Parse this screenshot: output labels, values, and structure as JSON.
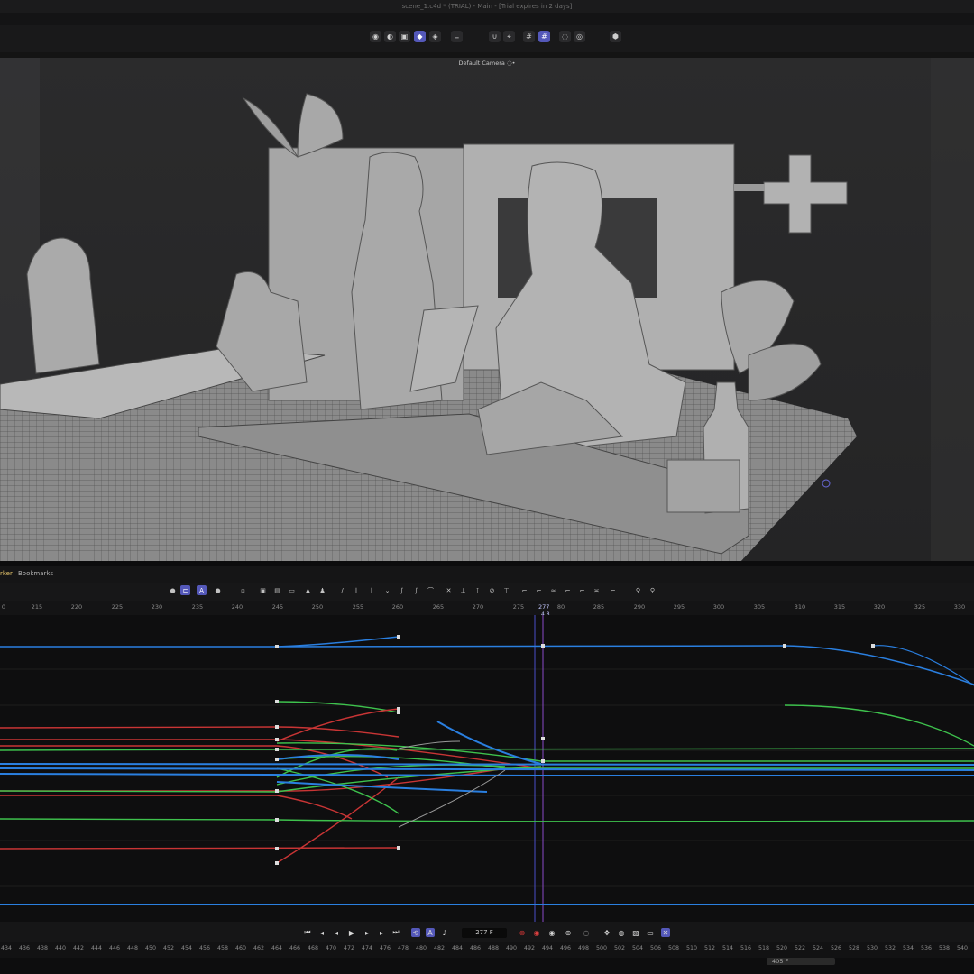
{
  "window": {
    "title": "scene_1.c4d * (TRIAL) - Main - [Trial expires in 2 days]"
  },
  "viewport": {
    "camera_label": "Default Camera ◌•"
  },
  "toolbar": {
    "icons": [
      "view-icon",
      "light-icon",
      "cube-icon",
      "display-icon",
      "shading-icon",
      "snap-icon",
      "magnet-icon",
      "grid-icon",
      "grid2-icon",
      "render-icon",
      "settings-icon",
      "axis-icon"
    ]
  },
  "timeline": {
    "tabs": [
      "rker",
      "Bookmarks"
    ],
    "ruler_ticks": [
      "0",
      "215",
      "220",
      "225",
      "230",
      "235",
      "240",
      "245",
      "250",
      "255",
      "260",
      "265",
      "270",
      "275",
      "80",
      "285",
      "290",
      "295",
      "300",
      "305",
      "310",
      "315",
      "320",
      "325",
      "330"
    ],
    "playhead_frame": "277",
    "playhead_sub": "4.8"
  },
  "transport": {
    "frame_field": "277 F"
  },
  "bottom_ruler": {
    "ticks": [
      "434",
      "436",
      "438",
      "440",
      "442",
      "444",
      "446",
      "448",
      "450",
      "452",
      "454",
      "456",
      "458",
      "460",
      "462",
      "464",
      "466",
      "468",
      "470",
      "472",
      "474",
      "476",
      "478",
      "480",
      "482",
      "484",
      "486",
      "488",
      "490",
      "492",
      "494",
      "496",
      "498",
      "500",
      "502",
      "504",
      "506",
      "508",
      "510",
      "512",
      "514",
      "516",
      "518",
      "520",
      "522",
      "524",
      "526",
      "528",
      "530",
      "532",
      "534",
      "536",
      "538",
      "540"
    ],
    "range_label": "405 F"
  },
  "colors": {
    "accent": "#5458b9",
    "curve_blue": "#2a7fe0",
    "curve_red": "#c93535",
    "curve_green": "#3ec24d"
  }
}
